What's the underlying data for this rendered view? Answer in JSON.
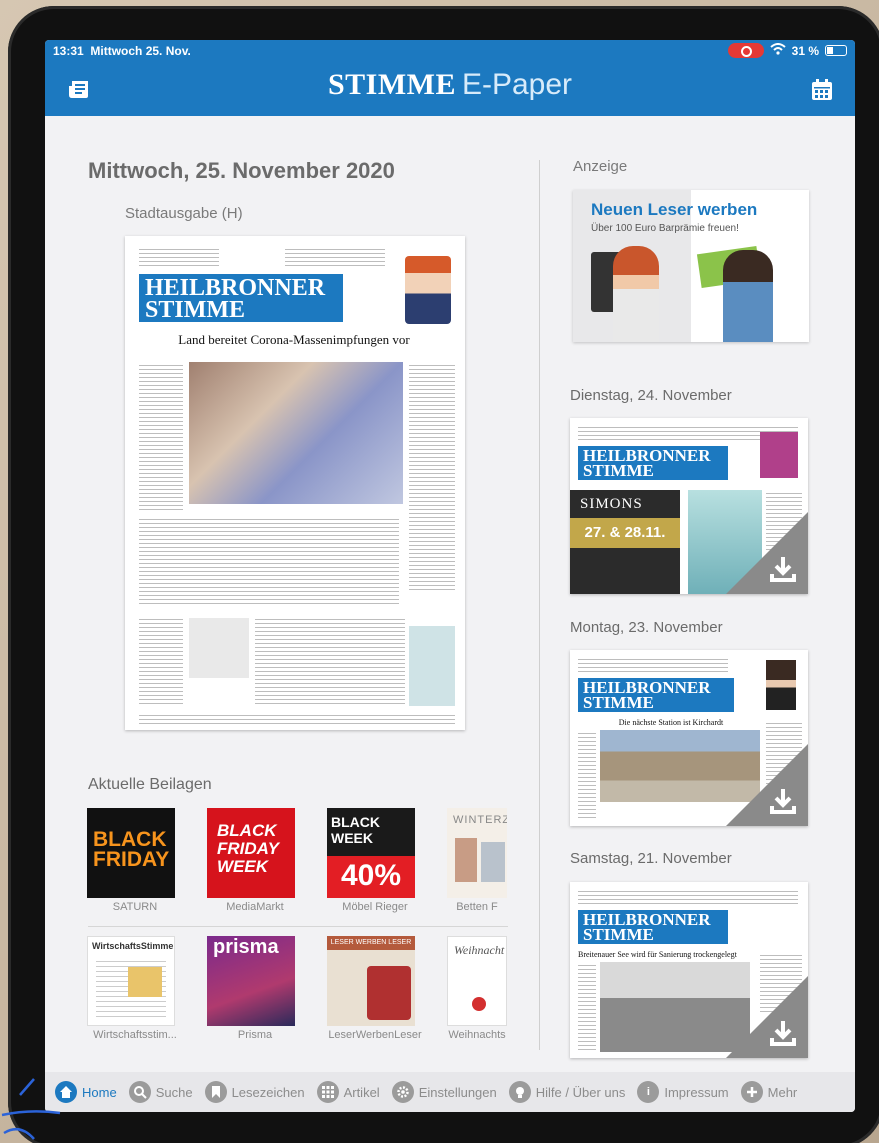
{
  "status": {
    "time": "13:31",
    "date": "Mittwoch 25. Nov.",
    "battery": "31 %"
  },
  "header": {
    "brand_main": "STIMME",
    "brand_sub": "E-Paper"
  },
  "main": {
    "date_title": "Mittwoch, 25. November 2020",
    "edition": "Stadtausgabe (H)",
    "front_page": {
      "masthead_line1": "HEILBRONNER",
      "masthead_line2": "STIMME",
      "headline": "Land bereitet Corona-Massenimpfungen vor"
    }
  },
  "beilagen": {
    "title": "Aktuelle Beilagen",
    "items": [
      {
        "label": "SATURN",
        "line1": "BLACK",
        "line2": "FRIDAY"
      },
      {
        "label": "MediaMarkt",
        "line1": "BLACK",
        "line2": "FRIDAY WEEK"
      },
      {
        "label": "Möbel Rieger",
        "line1": "BLACK WEEK",
        "line2": "40%"
      },
      {
        "label": "Betten F",
        "line1": "WINTERZA",
        "line2": ""
      },
      {
        "label": "Wirtschaftsstim...",
        "line1": "WirtschaftsStimme",
        "line2": ""
      },
      {
        "label": "Prisma",
        "line1": "prisma",
        "line2": ""
      },
      {
        "label": "LeserWerbenLeser",
        "line1": "LESER WERBEN LESER",
        "line2": ""
      },
      {
        "label": "Weihnachts",
        "line1": "Weihnacht",
        "line2": ""
      }
    ]
  },
  "ad": {
    "label": "Anzeige",
    "title": "Neuen Leser werben",
    "subtitle": "Über 100 Euro Barprämie freuen!"
  },
  "past_issues": [
    {
      "label": "Dienstag, 24. November",
      "mast1": "HEILBRONNER",
      "mast2": "STIMME",
      "ad_text": "SIMONS",
      "ad_date": "27. & 28.11."
    },
    {
      "label": "Montag, 23. November",
      "mast1": "HEILBRONNER",
      "mast2": "STIMME",
      "headline": "Die nächste Station ist Kirchardt"
    },
    {
      "label": "Samstag, 21. November",
      "mast1": "HEILBRONNER",
      "mast2": "STIMME",
      "headline": "Breitenauer See wird für Sanierung trockengelegt"
    }
  ],
  "tabbar": [
    {
      "label": "Home",
      "icon": "home-icon"
    },
    {
      "label": "Suche",
      "icon": "search-icon"
    },
    {
      "label": "Lesezeichen",
      "icon": "bookmark-icon"
    },
    {
      "label": "Artikel",
      "icon": "grid-icon"
    },
    {
      "label": "Einstellungen",
      "icon": "gear-icon"
    },
    {
      "label": "Hilfe / Über uns",
      "icon": "help-icon"
    },
    {
      "label": "Impressum",
      "icon": "info-icon"
    },
    {
      "label": "Mehr",
      "icon": "plus-icon"
    }
  ],
  "colors": {
    "brand": "#1c79c0",
    "background": "#f2f2f4",
    "inactive": "#9b9b9b"
  }
}
